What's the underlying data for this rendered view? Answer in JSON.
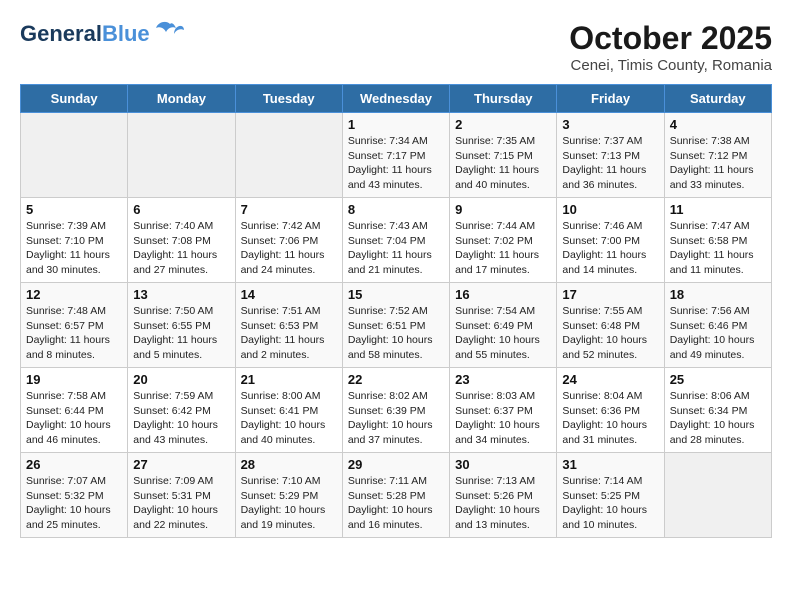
{
  "header": {
    "logo_general": "General",
    "logo_blue": "Blue",
    "title": "October 2025",
    "subtitle": "Cenei, Timis County, Romania"
  },
  "weekdays": [
    "Sunday",
    "Monday",
    "Tuesday",
    "Wednesday",
    "Thursday",
    "Friday",
    "Saturday"
  ],
  "weeks": [
    [
      {
        "day": "",
        "info": ""
      },
      {
        "day": "",
        "info": ""
      },
      {
        "day": "",
        "info": ""
      },
      {
        "day": "1",
        "info": "Sunrise: 7:34 AM\nSunset: 7:17 PM\nDaylight: 11 hours\nand 43 minutes."
      },
      {
        "day": "2",
        "info": "Sunrise: 7:35 AM\nSunset: 7:15 PM\nDaylight: 11 hours\nand 40 minutes."
      },
      {
        "day": "3",
        "info": "Sunrise: 7:37 AM\nSunset: 7:13 PM\nDaylight: 11 hours\nand 36 minutes."
      },
      {
        "day": "4",
        "info": "Sunrise: 7:38 AM\nSunset: 7:12 PM\nDaylight: 11 hours\nand 33 minutes."
      }
    ],
    [
      {
        "day": "5",
        "info": "Sunrise: 7:39 AM\nSunset: 7:10 PM\nDaylight: 11 hours\nand 30 minutes."
      },
      {
        "day": "6",
        "info": "Sunrise: 7:40 AM\nSunset: 7:08 PM\nDaylight: 11 hours\nand 27 minutes."
      },
      {
        "day": "7",
        "info": "Sunrise: 7:42 AM\nSunset: 7:06 PM\nDaylight: 11 hours\nand 24 minutes."
      },
      {
        "day": "8",
        "info": "Sunrise: 7:43 AM\nSunset: 7:04 PM\nDaylight: 11 hours\nand 21 minutes."
      },
      {
        "day": "9",
        "info": "Sunrise: 7:44 AM\nSunset: 7:02 PM\nDaylight: 11 hours\nand 17 minutes."
      },
      {
        "day": "10",
        "info": "Sunrise: 7:46 AM\nSunset: 7:00 PM\nDaylight: 11 hours\nand 14 minutes."
      },
      {
        "day": "11",
        "info": "Sunrise: 7:47 AM\nSunset: 6:58 PM\nDaylight: 11 hours\nand 11 minutes."
      }
    ],
    [
      {
        "day": "12",
        "info": "Sunrise: 7:48 AM\nSunset: 6:57 PM\nDaylight: 11 hours\nand 8 minutes."
      },
      {
        "day": "13",
        "info": "Sunrise: 7:50 AM\nSunset: 6:55 PM\nDaylight: 11 hours\nand 5 minutes."
      },
      {
        "day": "14",
        "info": "Sunrise: 7:51 AM\nSunset: 6:53 PM\nDaylight: 11 hours\nand 2 minutes."
      },
      {
        "day": "15",
        "info": "Sunrise: 7:52 AM\nSunset: 6:51 PM\nDaylight: 10 hours\nand 58 minutes."
      },
      {
        "day": "16",
        "info": "Sunrise: 7:54 AM\nSunset: 6:49 PM\nDaylight: 10 hours\nand 55 minutes."
      },
      {
        "day": "17",
        "info": "Sunrise: 7:55 AM\nSunset: 6:48 PM\nDaylight: 10 hours\nand 52 minutes."
      },
      {
        "day": "18",
        "info": "Sunrise: 7:56 AM\nSunset: 6:46 PM\nDaylight: 10 hours\nand 49 minutes."
      }
    ],
    [
      {
        "day": "19",
        "info": "Sunrise: 7:58 AM\nSunset: 6:44 PM\nDaylight: 10 hours\nand 46 minutes."
      },
      {
        "day": "20",
        "info": "Sunrise: 7:59 AM\nSunset: 6:42 PM\nDaylight: 10 hours\nand 43 minutes."
      },
      {
        "day": "21",
        "info": "Sunrise: 8:00 AM\nSunset: 6:41 PM\nDaylight: 10 hours\nand 40 minutes."
      },
      {
        "day": "22",
        "info": "Sunrise: 8:02 AM\nSunset: 6:39 PM\nDaylight: 10 hours\nand 37 minutes."
      },
      {
        "day": "23",
        "info": "Sunrise: 8:03 AM\nSunset: 6:37 PM\nDaylight: 10 hours\nand 34 minutes."
      },
      {
        "day": "24",
        "info": "Sunrise: 8:04 AM\nSunset: 6:36 PM\nDaylight: 10 hours\nand 31 minutes."
      },
      {
        "day": "25",
        "info": "Sunrise: 8:06 AM\nSunset: 6:34 PM\nDaylight: 10 hours\nand 28 minutes."
      }
    ],
    [
      {
        "day": "26",
        "info": "Sunrise: 7:07 AM\nSunset: 5:32 PM\nDaylight: 10 hours\nand 25 minutes."
      },
      {
        "day": "27",
        "info": "Sunrise: 7:09 AM\nSunset: 5:31 PM\nDaylight: 10 hours\nand 22 minutes."
      },
      {
        "day": "28",
        "info": "Sunrise: 7:10 AM\nSunset: 5:29 PM\nDaylight: 10 hours\nand 19 minutes."
      },
      {
        "day": "29",
        "info": "Sunrise: 7:11 AM\nSunset: 5:28 PM\nDaylight: 10 hours\nand 16 minutes."
      },
      {
        "day": "30",
        "info": "Sunrise: 7:13 AM\nSunset: 5:26 PM\nDaylight: 10 hours\nand 13 minutes."
      },
      {
        "day": "31",
        "info": "Sunrise: 7:14 AM\nSunset: 5:25 PM\nDaylight: 10 hours\nand 10 minutes."
      },
      {
        "day": "",
        "info": ""
      }
    ]
  ]
}
